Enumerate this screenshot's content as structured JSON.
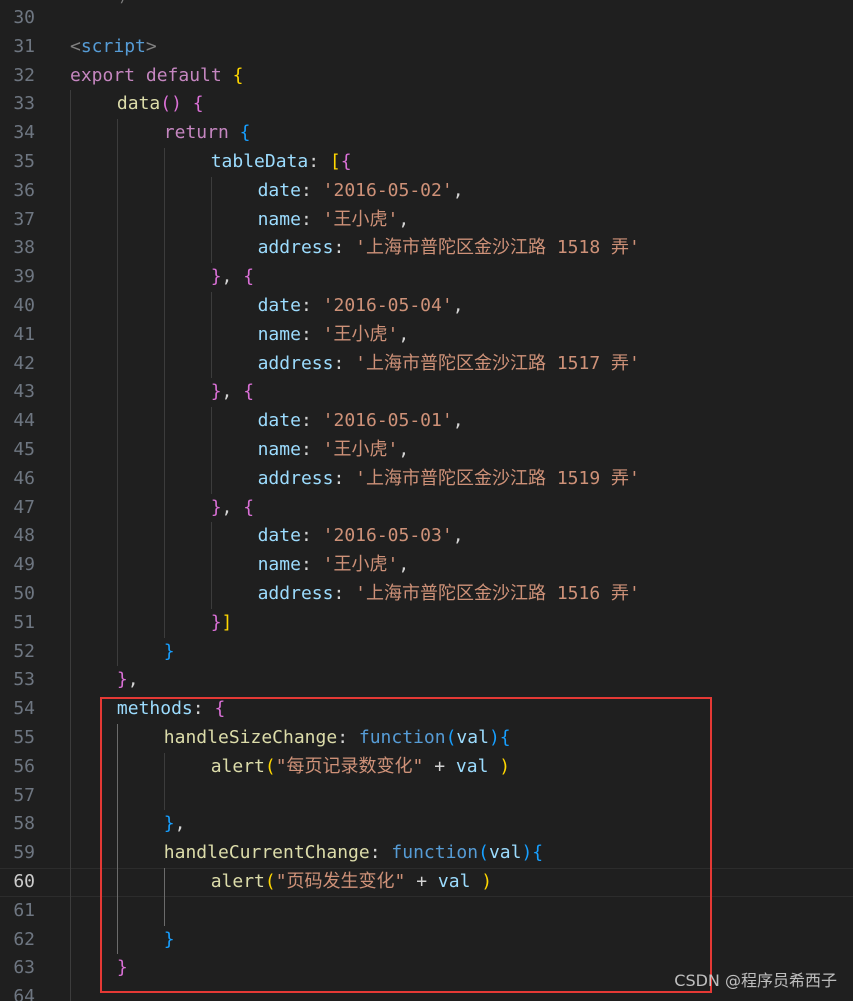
{
  "editor": {
    "title_fragment": "/",
    "current_line": 60,
    "watermark": "CSDN @程序员希西子",
    "lines": [
      {
        "n": 30,
        "tokens": []
      },
      {
        "n": 31,
        "tokens": [
          [
            "t",
            "<"
          ],
          [
            "tag",
            "script"
          ],
          [
            "t",
            ">"
          ]
        ]
      },
      {
        "n": 32,
        "tokens": [
          [
            "kw",
            "export"
          ],
          [
            "p",
            " "
          ],
          [
            "kw",
            "default"
          ],
          [
            "p",
            " "
          ],
          [
            "b1",
            "{"
          ]
        ]
      },
      {
        "n": 33,
        "tokens": [
          [
            "fn",
            "data"
          ],
          [
            "b2",
            "()"
          ],
          [
            "p",
            " "
          ],
          [
            "b2",
            "{"
          ]
        ]
      },
      {
        "n": 34,
        "tokens": [
          [
            "kw",
            "return"
          ],
          [
            "p",
            " "
          ],
          [
            "b3",
            "{"
          ]
        ]
      },
      {
        "n": 35,
        "tokens": [
          [
            "prop",
            "tableData"
          ],
          [
            "p",
            ": "
          ],
          [
            "b1",
            "["
          ],
          [
            "b2",
            "{"
          ]
        ]
      },
      {
        "n": 36,
        "tokens": [
          [
            "prop",
            "date"
          ],
          [
            "p",
            ": "
          ],
          [
            "str",
            "'2016-05-02'"
          ],
          [
            "p",
            ","
          ]
        ]
      },
      {
        "n": 37,
        "tokens": [
          [
            "prop",
            "name"
          ],
          [
            "p",
            ": "
          ],
          [
            "str",
            "'王小虎'"
          ],
          [
            "p",
            ","
          ]
        ]
      },
      {
        "n": 38,
        "tokens": [
          [
            "prop",
            "address"
          ],
          [
            "p",
            ": "
          ],
          [
            "str",
            "'上海市普陀区金沙江路 1518 弄'"
          ]
        ]
      },
      {
        "n": 39,
        "tokens": [
          [
            "b2",
            "}"
          ],
          [
            "p",
            ", "
          ],
          [
            "b2",
            "{"
          ]
        ]
      },
      {
        "n": 40,
        "tokens": [
          [
            "prop",
            "date"
          ],
          [
            "p",
            ": "
          ],
          [
            "str",
            "'2016-05-04'"
          ],
          [
            "p",
            ","
          ]
        ]
      },
      {
        "n": 41,
        "tokens": [
          [
            "prop",
            "name"
          ],
          [
            "p",
            ": "
          ],
          [
            "str",
            "'王小虎'"
          ],
          [
            "p",
            ","
          ]
        ]
      },
      {
        "n": 42,
        "tokens": [
          [
            "prop",
            "address"
          ],
          [
            "p",
            ": "
          ],
          [
            "str",
            "'上海市普陀区金沙江路 1517 弄'"
          ]
        ]
      },
      {
        "n": 43,
        "tokens": [
          [
            "b2",
            "}"
          ],
          [
            "p",
            ", "
          ],
          [
            "b2",
            "{"
          ]
        ]
      },
      {
        "n": 44,
        "tokens": [
          [
            "prop",
            "date"
          ],
          [
            "p",
            ": "
          ],
          [
            "str",
            "'2016-05-01'"
          ],
          [
            "p",
            ","
          ]
        ]
      },
      {
        "n": 45,
        "tokens": [
          [
            "prop",
            "name"
          ],
          [
            "p",
            ": "
          ],
          [
            "str",
            "'王小虎'"
          ],
          [
            "p",
            ","
          ]
        ]
      },
      {
        "n": 46,
        "tokens": [
          [
            "prop",
            "address"
          ],
          [
            "p",
            ": "
          ],
          [
            "str",
            "'上海市普陀区金沙江路 1519 弄'"
          ]
        ]
      },
      {
        "n": 47,
        "tokens": [
          [
            "b2",
            "}"
          ],
          [
            "p",
            ", "
          ],
          [
            "b2",
            "{"
          ]
        ]
      },
      {
        "n": 48,
        "tokens": [
          [
            "prop",
            "date"
          ],
          [
            "p",
            ": "
          ],
          [
            "str",
            "'2016-05-03'"
          ],
          [
            "p",
            ","
          ]
        ]
      },
      {
        "n": 49,
        "tokens": [
          [
            "prop",
            "name"
          ],
          [
            "p",
            ": "
          ],
          [
            "str",
            "'王小虎'"
          ],
          [
            "p",
            ","
          ]
        ]
      },
      {
        "n": 50,
        "tokens": [
          [
            "prop",
            "address"
          ],
          [
            "p",
            ": "
          ],
          [
            "str",
            "'上海市普陀区金沙江路 1516 弄'"
          ]
        ]
      },
      {
        "n": 51,
        "tokens": [
          [
            "b2",
            "}"
          ],
          [
            "b1",
            "]"
          ]
        ]
      },
      {
        "n": 52,
        "tokens": [
          [
            "b3",
            "}"
          ]
        ]
      },
      {
        "n": 53,
        "tokens": [
          [
            "b2",
            "}"
          ],
          [
            "p",
            ","
          ]
        ]
      },
      {
        "n": 54,
        "tokens": [
          [
            "prop",
            "methods"
          ],
          [
            "p",
            ": "
          ],
          [
            "b2",
            "{"
          ]
        ]
      },
      {
        "n": 55,
        "tokens": [
          [
            "fn",
            "handleSizeChange"
          ],
          [
            "p",
            ": "
          ],
          [
            "fk",
            "function"
          ],
          [
            "b3",
            "("
          ],
          [
            "var",
            "val"
          ],
          [
            "b3",
            ")"
          ],
          [
            "b3",
            "{"
          ]
        ]
      },
      {
        "n": 56,
        "tokens": [
          [
            "fn",
            "alert"
          ],
          [
            "b1",
            "("
          ],
          [
            "str",
            "\"每页记录数变化\""
          ],
          [
            "p",
            " + "
          ],
          [
            "var",
            "val"
          ],
          [
            "p",
            " "
          ],
          [
            "b1",
            ")"
          ]
        ]
      },
      {
        "n": 57,
        "tokens": []
      },
      {
        "n": 58,
        "tokens": [
          [
            "b3",
            "}"
          ],
          [
            "p",
            ","
          ]
        ]
      },
      {
        "n": 59,
        "tokens": [
          [
            "fn",
            "handleCurrentChange"
          ],
          [
            "p",
            ": "
          ],
          [
            "fk",
            "function"
          ],
          [
            "b3",
            "("
          ],
          [
            "var",
            "val"
          ],
          [
            "b3",
            ")"
          ],
          [
            "b3",
            "{"
          ]
        ]
      },
      {
        "n": 60,
        "tokens": [
          [
            "fn",
            "alert"
          ],
          [
            "b1",
            "("
          ],
          [
            "str",
            "\"页码发生变化\""
          ],
          [
            "p",
            " + "
          ],
          [
            "var",
            "val"
          ],
          [
            "p",
            " "
          ],
          [
            "b1",
            ")"
          ]
        ]
      },
      {
        "n": 61,
        "tokens": []
      },
      {
        "n": 62,
        "tokens": [
          [
            "b3",
            "}"
          ]
        ]
      },
      {
        "n": 63,
        "tokens": [
          [
            "b2",
            "}"
          ]
        ]
      },
      {
        "n": 64,
        "tokens": []
      }
    ]
  }
}
